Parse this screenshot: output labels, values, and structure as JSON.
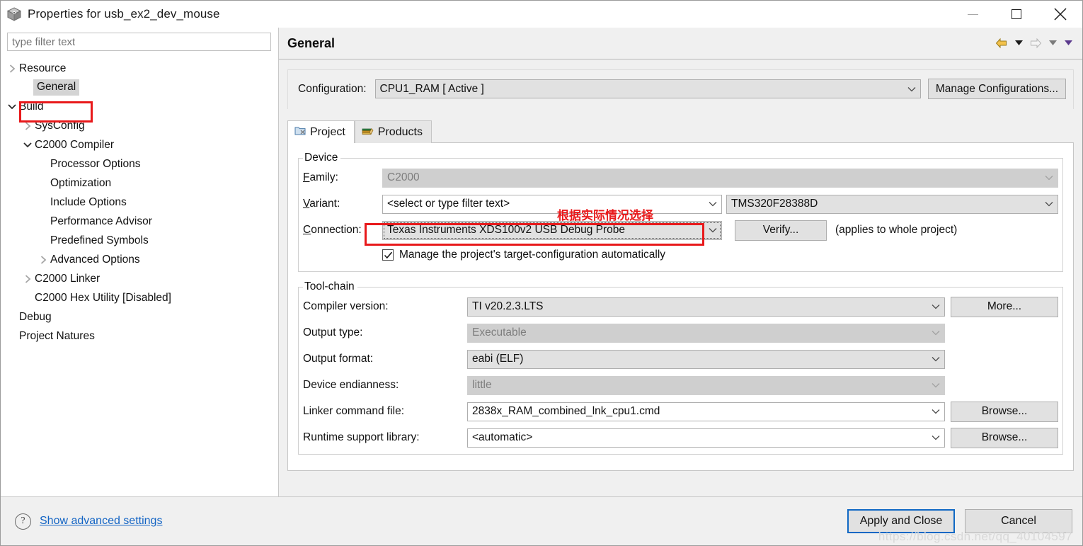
{
  "window": {
    "title": "Properties for usb_ex2_dev_mouse",
    "app_icon": "cube-icon",
    "controls": {
      "minimize": "minimize-icon",
      "maximize": "maximize-icon",
      "close": "close-icon"
    }
  },
  "sidebar": {
    "filter_placeholder": "type filter text",
    "filter_value": "",
    "items": [
      {
        "label": "Resource",
        "indent": 0,
        "twisty": "collapsed",
        "selected": false
      },
      {
        "label": "General",
        "indent": 1,
        "twisty": "none",
        "selected": true
      },
      {
        "label": "Build",
        "indent": 0,
        "twisty": "expanded",
        "selected": false
      },
      {
        "label": "SysConfig",
        "indent": 1,
        "twisty": "collapsed",
        "selected": false
      },
      {
        "label": "C2000 Compiler",
        "indent": 1,
        "twisty": "expanded",
        "selected": false
      },
      {
        "label": "Processor Options",
        "indent": 2,
        "twisty": "none",
        "selected": false
      },
      {
        "label": "Optimization",
        "indent": 2,
        "twisty": "none",
        "selected": false
      },
      {
        "label": "Include Options",
        "indent": 2,
        "twisty": "none",
        "selected": false
      },
      {
        "label": "Performance Advisor",
        "indent": 2,
        "twisty": "none",
        "selected": false
      },
      {
        "label": "Predefined Symbols",
        "indent": 2,
        "twisty": "none",
        "selected": false
      },
      {
        "label": "Advanced Options",
        "indent": 2,
        "twisty": "collapsed",
        "selected": false
      },
      {
        "label": "C2000 Linker",
        "indent": 1,
        "twisty": "collapsed",
        "selected": false
      },
      {
        "label": "C2000 Hex Utility  [Disabled]",
        "indent": 1,
        "twisty": "none",
        "selected": false
      },
      {
        "label": "Debug",
        "indent": 0,
        "twisty": "none",
        "selected": false
      },
      {
        "label": "Project Natures",
        "indent": 0,
        "twisty": "none",
        "selected": false
      }
    ]
  },
  "page": {
    "title": "General",
    "nav": {
      "back": "back-arrow-icon",
      "back_menu": "chevron-down-icon",
      "forward": "forward-arrow-icon",
      "forward_menu": "chevron-down-icon",
      "view_menu": "chevron-down-icon"
    }
  },
  "configuration": {
    "label": "Configuration:",
    "value": "CPU1_RAM  [ Active ]",
    "manage_button": "Manage Configurations..."
  },
  "tabs": [
    {
      "label": "Project",
      "icon": "project-icon",
      "active": true
    },
    {
      "label": "Products",
      "icon": "books-icon",
      "active": false
    }
  ],
  "device": {
    "legend": "Device",
    "family": {
      "label": "Family:",
      "label_mnemonic": "F",
      "value": "C2000",
      "disabled": true
    },
    "variant": {
      "label": "Variant:",
      "label_mnemonic": "V",
      "filter_value": "<select or type filter text>",
      "value": "TMS320F28388D"
    },
    "connection": {
      "label": "Connection:",
      "label_mnemonic": "C",
      "value": "Texas Instruments XDS100v2 USB Debug Probe",
      "verify_button": "Verify...",
      "note": "(applies to whole project)"
    },
    "manage_checkbox": {
      "label": "Manage the project's target-configuration automatically",
      "checked": true
    }
  },
  "toolchain": {
    "legend": "Tool-chain",
    "rows": [
      {
        "label": "Compiler version:",
        "value": "TI v20.2.3.LTS",
        "disabled": false,
        "button": "More...",
        "button_mnemonic": "M"
      },
      {
        "label": "Output type:",
        "value": "Executable",
        "disabled": true,
        "button": "",
        "button_mnemonic": ""
      },
      {
        "label": "Output format:",
        "value": "eabi (ELF)",
        "disabled": false,
        "button": "",
        "button_mnemonic": ""
      },
      {
        "label": "Device endianness:",
        "value": "little",
        "disabled": true,
        "button": "",
        "button_mnemonic": ""
      },
      {
        "label": "Linker command file:",
        "value": "2838x_RAM_combined_lnk_cpu1.cmd",
        "disabled": false,
        "button": "Browse...",
        "button_mnemonic": "r",
        "white": true
      },
      {
        "label": "Runtime support library:",
        "value": "<automatic>",
        "disabled": false,
        "button": "Browse...",
        "button_mnemonic": "r",
        "white": true
      }
    ]
  },
  "annotations": {
    "variant_note_cn": "根据实际情况选择",
    "highlight_color": "#e8191b"
  },
  "footer": {
    "help_icon": "question-mark-icon",
    "advanced_link": "Show advanced settings",
    "apply_button": "Apply and Close",
    "cancel_button": "Cancel"
  },
  "watermark": "https://blog.csdn.net/qq_40104597"
}
